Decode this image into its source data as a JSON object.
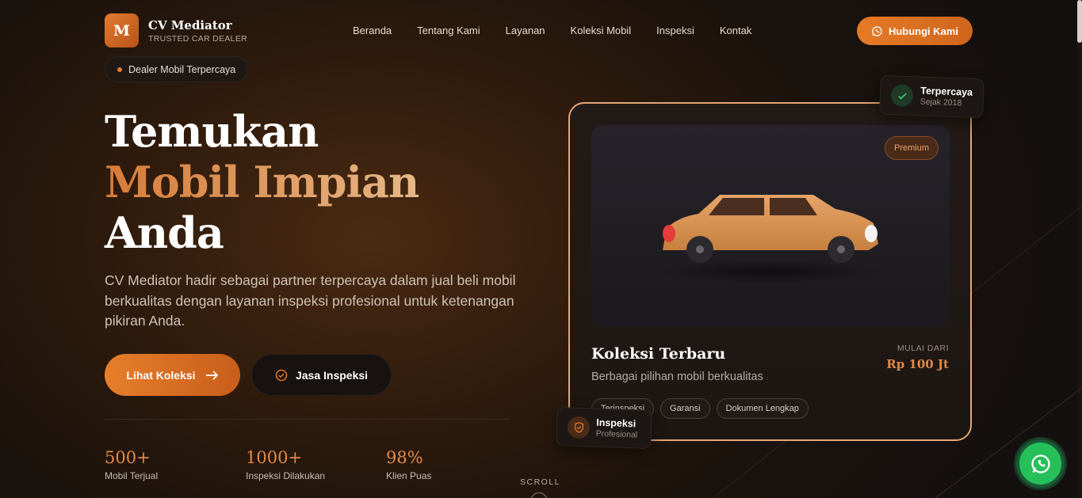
{
  "brand": {
    "mark": "M",
    "name": "CV Mediator",
    "tagline": "TRUSTED CAR DEALER"
  },
  "nav": {
    "items": [
      "Beranda",
      "Tentang Kami",
      "Layanan",
      "Koleksi Mobil",
      "Inspeksi",
      "Kontak"
    ]
  },
  "header_cta": {
    "label": "Hubungi Kami",
    "icon": "whatsapp-icon"
  },
  "badge": {
    "label": "Dealer Mobil Terpercaya"
  },
  "hero": {
    "line1": "Temukan",
    "line2": "Mobil Impian",
    "line3": "Anda",
    "description": "CV Mediator hadir sebagai partner terpercaya dalam jual beli mobil berkualitas dengan layanan inspeksi profesional untuk ketenangan pikiran Anda.",
    "primary_button": "Lihat Koleksi",
    "secondary_button": "Jasa Inspeksi"
  },
  "stats": [
    {
      "value": "500+",
      "label": "Mobil Terjual"
    },
    {
      "value": "1000+",
      "label": "Inspeksi Dilakukan"
    },
    {
      "value": "98%",
      "label": "Klien Puas"
    }
  ],
  "scroll_label": "SCROLL",
  "card": {
    "badge": "Premium",
    "title": "Koleksi Terbaru",
    "subtitle": "Berbagai pilihan mobil berkualitas",
    "price_label": "MULAI DARI",
    "price": "Rp 100 Jt",
    "tags": [
      "Terinspeksi",
      "Garansi",
      "Dokumen Lengkap"
    ]
  },
  "float_top": {
    "title": "Terpercaya",
    "subtitle": "Sejak 2018"
  },
  "float_bottom": {
    "title": "Inspeksi",
    "subtitle": "Profesional"
  },
  "colors": {
    "accent": "#e57a26",
    "gold": "#e38a47",
    "whatsapp": "#25c05a"
  }
}
